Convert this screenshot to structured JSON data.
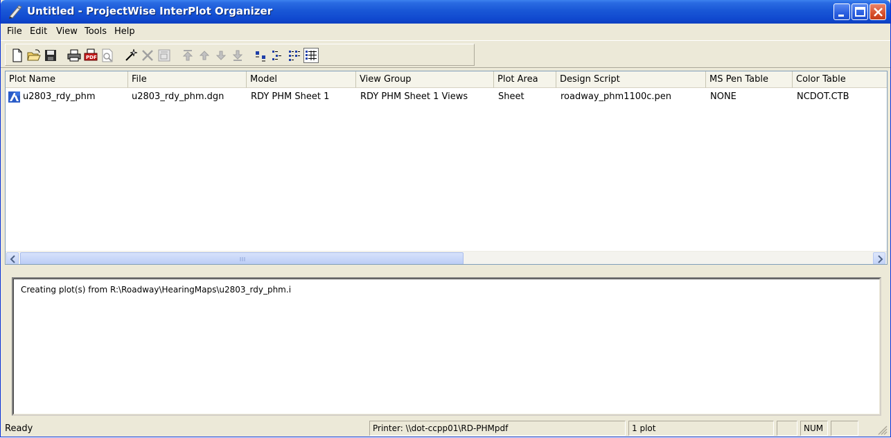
{
  "window": {
    "title": "Untitled - ProjectWise InterPlot Organizer"
  },
  "menu": [
    "File",
    "Edit",
    "View",
    "Tools",
    "Help"
  ],
  "toolbar": {
    "icons": [
      "new-icon",
      "open-icon",
      "save-icon",
      "print-icon",
      "pdf-icon",
      "preview-icon",
      "wand-icon",
      "delete-icon",
      "properties-icon",
      "move-top-icon",
      "move-up-icon",
      "move-down-icon",
      "move-bottom-icon",
      "large-icons-icon",
      "small-icons-icon",
      "list-icon",
      "details-icon"
    ]
  },
  "list": {
    "columns": [
      "Plot Name",
      "File",
      "Model",
      "View Group",
      "Plot Area",
      "Design Script",
      "MS Pen Table",
      "Color Table"
    ],
    "rows": [
      [
        "u2803_rdy_phm",
        "u2803_rdy_phm.dgn",
        "RDY PHM Sheet 1",
        "RDY PHM Sheet 1 Views",
        "Sheet",
        "roadway_phm1100c.pen",
        "NONE",
        "NCDOT.CTB"
      ]
    ]
  },
  "output": {
    "text": "Creating plot(s) from R:\\Roadway\\HearingMaps\\u2803_rdy_phm.i"
  },
  "status": {
    "ready": "Ready",
    "printer": "Printer: \\\\dot-ccpp01\\RD-PHMpdf",
    "count": "1 plot",
    "num": "NUM"
  },
  "colors": {
    "titlebar": "#0d3fc0",
    "chrome": "#ece9d8",
    "scroll": "#c1d2f7"
  }
}
